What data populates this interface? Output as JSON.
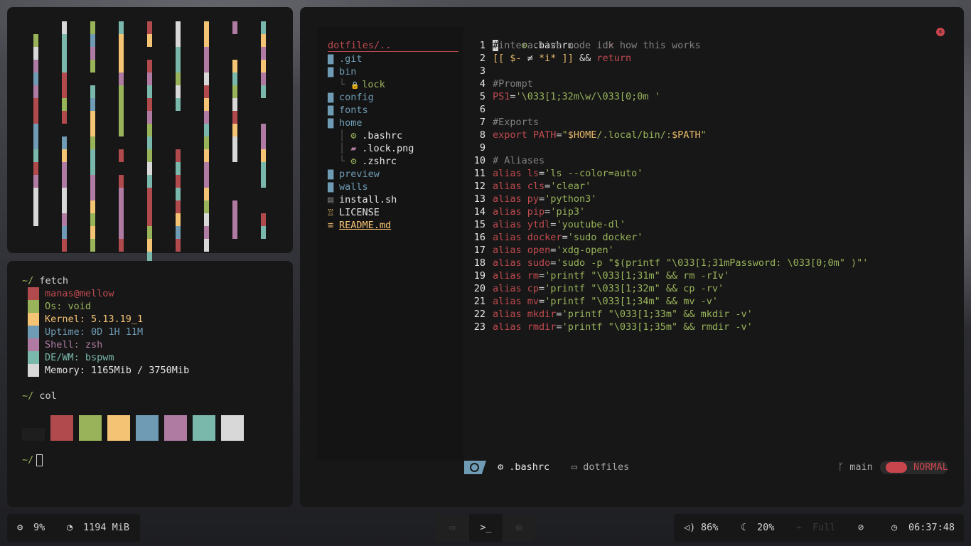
{
  "color_bars": {
    "palette": [
      "#b04a4d",
      "#98b35a",
      "#f5c374",
      "#6f9cb4",
      "#b07ba3",
      "#79b8ab",
      "#d8d8d8"
    ]
  },
  "terminal": {
    "prompt": "~/",
    "fetch_cmd": "fetch",
    "fetch_lines": [
      {
        "text": "manas@mellow",
        "color": "#c04a4f"
      },
      {
        "text": "Os: void",
        "color": "#98b35a"
      },
      {
        "text": "Kernel: 5.13.19_1",
        "color": "#f5c374"
      },
      {
        "text": "Uptime: 0D 1H 11M",
        "color": "#6f9cb4"
      },
      {
        "text": "Shell: zsh",
        "color": "#b07ba3"
      },
      {
        "text": "DE/WM: bspwm",
        "color": "#79b8ab"
      },
      {
        "text": "Memory: 1165Mib / 3750Mib",
        "color": "#e6e6e6"
      }
    ],
    "col_cmd": "col",
    "palette": [
      "#1e1e1e",
      "#b04a4d",
      "#98b35a",
      "#f5c374",
      "#6f9cb4",
      "#b07ba3",
      "#79b8ab",
      "#d8d8d8"
    ]
  },
  "editor": {
    "tab_label": ".bashrc",
    "tab_close": "✕",
    "tree": {
      "title": "dotfiles/..",
      "items": [
        {
          "label": ".git",
          "kind": "folder"
        },
        {
          "label": "bin",
          "kind": "folder"
        },
        {
          "label": "lock",
          "kind": "lock"
        },
        {
          "label": "config",
          "kind": "folder"
        },
        {
          "label": "fonts",
          "kind": "folder"
        },
        {
          "label": "home",
          "kind": "folder"
        },
        {
          "label": ".bashrc",
          "kind": "gear"
        },
        {
          "label": ".lock.png",
          "kind": "image"
        },
        {
          "label": ".zshrc",
          "kind": "gear"
        },
        {
          "label": "preview",
          "kind": "folder"
        },
        {
          "label": "walls",
          "kind": "folder"
        },
        {
          "label": "install.sh",
          "kind": "script"
        },
        {
          "label": "LICENSE",
          "kind": "license"
        },
        {
          "label": "README.md",
          "kind": "readme"
        }
      ]
    },
    "lines": [
      "#interactive mode idk how this works",
      "[[ $- ≠ *i* ]] && return",
      "",
      "#Prompt",
      "PS1='\\033[1;32m\\w/\\033[0;0m '",
      "",
      "#Exports",
      "export PATH=\"$HOME/.local/bin/:$PATH\"",
      "",
      "# Aliases",
      "alias ls='ls --color=auto'",
      "alias cls='clear'",
      "alias py='python3'",
      "alias pip='pip3'",
      "alias ytdl='youtube-dl'",
      "alias docker='sudo docker'",
      "alias open='xdg-open'",
      "alias sudo='sudo -p \"$(printf \"\\033[1;31mPassword: \\033[0;0m\" )\"'",
      "alias rm='printf \"\\033[1;31m\" && rm -rIv'",
      "alias cp='printf \"\\033[1;32m\" && cp -rv'",
      "alias mv='printf \"\\033[1;34m\" && mv -v'",
      "alias mkdir='printf \"\\033[1;33m\" && mkdir -v'",
      "alias rmdir='printf \"\\033[1;35m\" && rmdir -v'"
    ],
    "status": {
      "file": ".bashrc",
      "dir": "dotfiles",
      "branch": "main",
      "mode": "NORMAL"
    }
  },
  "taskbar": {
    "cpu": "9%",
    "mem": "1194 MiB",
    "volume": "86%",
    "brightness": "20%",
    "battery": "Full",
    "time": "06:37:48"
  }
}
